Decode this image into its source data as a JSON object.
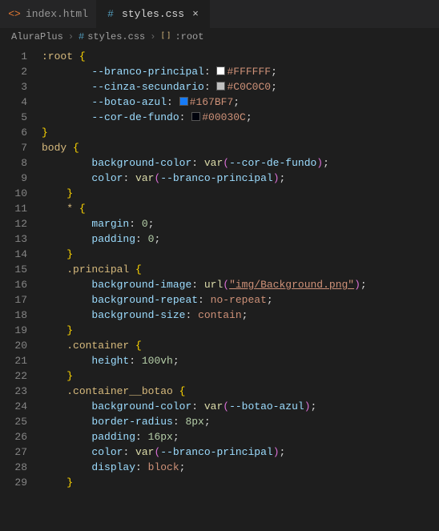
{
  "tabs": [
    {
      "label": "index.html",
      "active": false
    },
    {
      "label": "styles.css",
      "active": true
    }
  ],
  "breadcrumbs": {
    "folder": "AluraPlus",
    "file": "styles.css",
    "symbol": ":root"
  },
  "code": {
    "lines": [
      {
        "n": 1,
        "t": "selector_open",
        "sel": ":root"
      },
      {
        "n": 2,
        "t": "var_color",
        "prop": "--branco-principal",
        "val": "#FFFFFF",
        "swatch": "#FFFFFF"
      },
      {
        "n": 3,
        "t": "var_color",
        "prop": "--cinza-secundario",
        "val": "#C0C0C0",
        "swatch": "#C0C0C0"
      },
      {
        "n": 4,
        "t": "var_color",
        "prop": "--botao-azul",
        "val": "#167BF7",
        "swatch": "#167BF7"
      },
      {
        "n": 5,
        "t": "var_color",
        "prop": "--cor-de-fundo",
        "val": "#00030C",
        "swatch": "#00030C"
      },
      {
        "n": 6,
        "t": "close"
      },
      {
        "n": 7,
        "t": "selector_open",
        "sel": "body"
      },
      {
        "n": 8,
        "t": "decl_var",
        "prop": "background-color",
        "fn": "var",
        "arg": "--cor-de-fundo"
      },
      {
        "n": 9,
        "t": "decl_var",
        "prop": "color",
        "fn": "var",
        "arg": "--branco-principal"
      },
      {
        "n": 10,
        "t": "close_i1"
      },
      {
        "n": 11,
        "t": "selector_open_i1",
        "sel": "*"
      },
      {
        "n": 12,
        "t": "decl_num",
        "prop": "margin",
        "val": "0"
      },
      {
        "n": 13,
        "t": "decl_num",
        "prop": "padding",
        "val": "0"
      },
      {
        "n": 14,
        "t": "close_i1"
      },
      {
        "n": 15,
        "t": "selector_open_i1",
        "sel": ".principal"
      },
      {
        "n": 16,
        "t": "decl_url",
        "prop": "background-image",
        "fn": "url",
        "arg": "\"img/Background.png\""
      },
      {
        "n": 17,
        "t": "decl_str",
        "prop": "background-repeat",
        "val": "no-repeat"
      },
      {
        "n": 18,
        "t": "decl_str",
        "prop": "background-size",
        "val": "contain"
      },
      {
        "n": 19,
        "t": "close_i1"
      },
      {
        "n": 20,
        "t": "selector_open_i1",
        "sel": ".container"
      },
      {
        "n": 21,
        "t": "decl_num",
        "prop": "height",
        "val": "100vh"
      },
      {
        "n": 22,
        "t": "close_i1"
      },
      {
        "n": 23,
        "t": "selector_open_i1",
        "sel": ".container__botao"
      },
      {
        "n": 24,
        "t": "decl_var",
        "prop": "background-color",
        "fn": "var",
        "arg": "--botao-azul"
      },
      {
        "n": 25,
        "t": "decl_num",
        "prop": "border-radius",
        "val": "8px"
      },
      {
        "n": 26,
        "t": "decl_num",
        "prop": "padding",
        "val": "16px"
      },
      {
        "n": 27,
        "t": "decl_var",
        "prop": "color",
        "fn": "var",
        "arg": "--branco-principal"
      },
      {
        "n": 28,
        "t": "decl_str",
        "prop": "display",
        "val": "block"
      },
      {
        "n": 29,
        "t": "close_i1"
      }
    ]
  }
}
